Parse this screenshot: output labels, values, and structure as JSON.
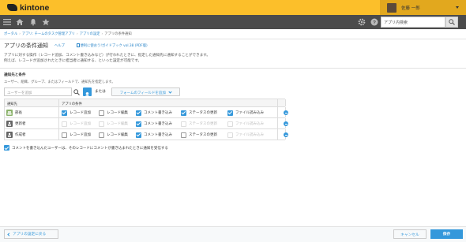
{
  "app": {
    "logo_text": "kintone"
  },
  "header": {
    "user_name": "佐藤 一郎",
    "brand_color": "#fcbf2a"
  },
  "globalbar": {
    "search_placeholder": "アプリ内検索",
    "icons": [
      "menu-icon",
      "home-icon",
      "bell-icon",
      "star-icon",
      "gear-icon",
      "help-icon",
      "search-icon"
    ]
  },
  "breadcrumb": [
    "ポータル",
    "アプリ: チームのタスク管理アプリ",
    "アプリの設定",
    "アプリの条件通知"
  ],
  "page": {
    "title": "アプリの条件通知",
    "help_link": "ヘルプ",
    "guide_link": "便利に使おう!ガイドブック vol.38 (PDF版)",
    "desc_line1": "アプリに対する操作（レコード追加、コメント書き込みなど）が行われたときに、指定した通知先に通知することができます。",
    "desc_line2": "例えば、レコードが追加されたときに担当者に通知する、といった設定が可能です。"
  },
  "section": {
    "title": "通知先と条件",
    "description": "ユーザー、組織、グループ、またはフィールドで、通知先を指定します。",
    "user_placeholder": "ユーザーを追加",
    "or_label": "または",
    "field_button": "フォームのフィールドを追加"
  },
  "table": {
    "col_target": "通知先",
    "col_conditions": "アプリの条件",
    "rows": [
      {
        "name": "部長",
        "type": "group",
        "conditions": [
          {
            "label": "レコード追加",
            "checked": true,
            "enabled": true
          },
          {
            "label": "レコード編集",
            "checked": false,
            "enabled": true
          },
          {
            "label": "コメント書き込み",
            "checked": true,
            "enabled": true
          },
          {
            "label": "ステータスの更新",
            "checked": true,
            "enabled": true
          },
          {
            "label": "ファイル読み込み",
            "checked": true,
            "enabled": true
          }
        ]
      },
      {
        "name": "更新者",
        "type": "field",
        "conditions": [
          {
            "label": "レコード追加",
            "checked": false,
            "enabled": false
          },
          {
            "label": "レコード編集",
            "checked": false,
            "enabled": false
          },
          {
            "label": "コメント書き込み",
            "checked": true,
            "enabled": true
          },
          {
            "label": "ステータスの更新",
            "checked": false,
            "enabled": false
          },
          {
            "label": "ファイル読み込み",
            "checked": false,
            "enabled": false
          }
        ]
      },
      {
        "name": "作成者",
        "type": "field",
        "conditions": [
          {
            "label": "レコード追加",
            "checked": false,
            "enabled": true
          },
          {
            "label": "レコード編集",
            "checked": false,
            "enabled": true
          },
          {
            "label": "コメント書き込み",
            "checked": true,
            "enabled": true
          },
          {
            "label": "ステータスの更新",
            "checked": false,
            "enabled": true
          },
          {
            "label": "ファイル読み込み",
            "checked": false,
            "enabled": false
          }
        ]
      }
    ]
  },
  "footer_checkbox": {
    "label": "コメントを書き込んだユーザーは、そのレコードにコメントが書き込まれたときに通知を受信する",
    "checked": true
  },
  "actions": {
    "back": "アプリの設定に戻る",
    "cancel": "キャンセル",
    "save": "保存"
  },
  "colors": {
    "accent": "#3498db",
    "group_icon": "#8bb26b",
    "field_icon": "#666666"
  }
}
